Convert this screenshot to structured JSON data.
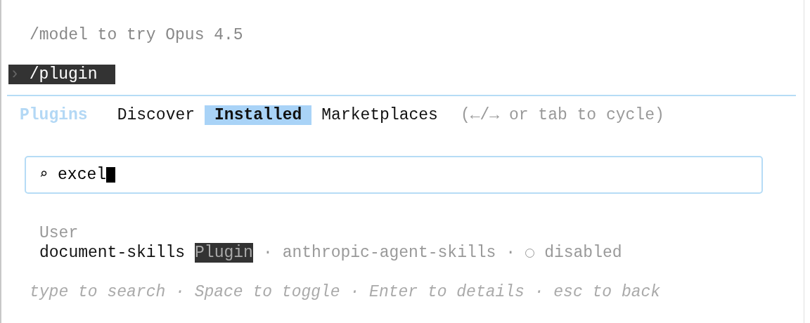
{
  "tip": "/model to try Opus 4.5",
  "prompt": {
    "marker": "›",
    "command": "/plugin"
  },
  "tabs_title": "Plugins",
  "tabs": [
    {
      "label": "Discover",
      "selected": false
    },
    {
      "label": "Installed",
      "selected": true
    },
    {
      "label": "Marketplaces",
      "selected": false
    }
  ],
  "tabs_hint": "(←/→ or tab to cycle)",
  "search": {
    "icon": "⌕",
    "value": "excel"
  },
  "sections": [
    {
      "title": "User",
      "items": [
        {
          "name": "document-skills",
          "badge": "Plugin",
          "source": "anthropic-agent-skills",
          "separator": "·",
          "enabled": false,
          "status": "disabled"
        }
      ]
    }
  ],
  "footer": "type to search · Space to toggle · Enter to details · esc to back"
}
